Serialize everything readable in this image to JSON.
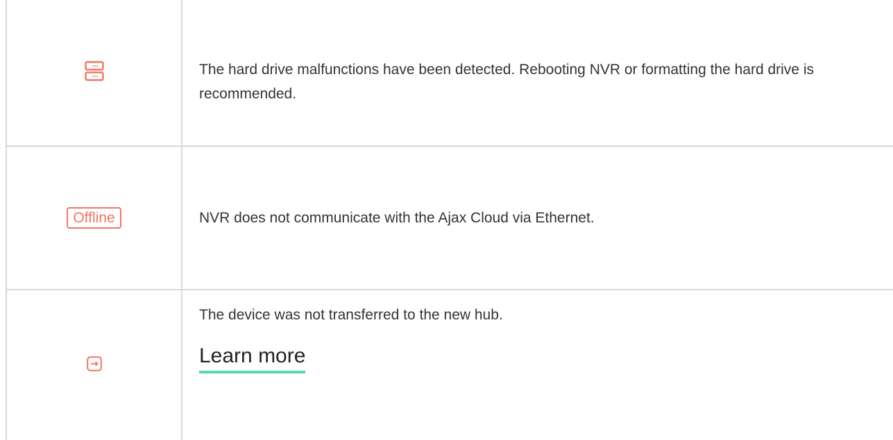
{
  "rows": [
    {
      "icon": "hard-drive-icon",
      "text": "The hard drive malfunctions have been detected. Rebooting NVR or formatting the hard drive is recommended."
    },
    {
      "badge": "Offline",
      "text": "NVR does not communicate with the Ajax Cloud via Ethernet."
    },
    {
      "icon": "transfer-arrow-icon",
      "text": "The device was not transferred to the new hub.",
      "link": "Learn more"
    }
  ],
  "colors": {
    "icon_accent": "#f27462",
    "link_underline": "#5ad8a6",
    "border": "#d8d8d8"
  }
}
